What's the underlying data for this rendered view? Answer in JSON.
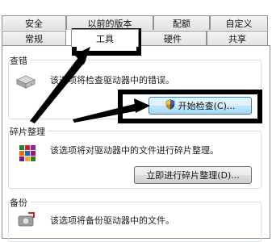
{
  "tabs_row1": [
    {
      "label": "安全"
    },
    {
      "label": "以前的版本"
    },
    {
      "label": "配额"
    },
    {
      "label": "自定义"
    }
  ],
  "tabs_row2": [
    {
      "label": "常规"
    },
    {
      "label": "工具",
      "selected": true
    },
    {
      "label": "硬件"
    },
    {
      "label": "共享"
    }
  ],
  "error_check": {
    "title": "查错",
    "description": "该选项将检查驱动器中的错误。",
    "button_label": "开始检查(C)...",
    "icon": "hard-drive-icon"
  },
  "defrag": {
    "title": "碎片整理",
    "description": "该选项将对驱动器中的文件进行碎片整理。",
    "button_label": "立即进行碎片整理(D)...",
    "icon": "defrag-icon"
  },
  "backup": {
    "title": "备份",
    "description": "该选项将备份驱动器中的文件。",
    "icon": "backup-icon"
  },
  "colors": {
    "annotation": "#000000",
    "focus_border": "#3c7fb1"
  }
}
